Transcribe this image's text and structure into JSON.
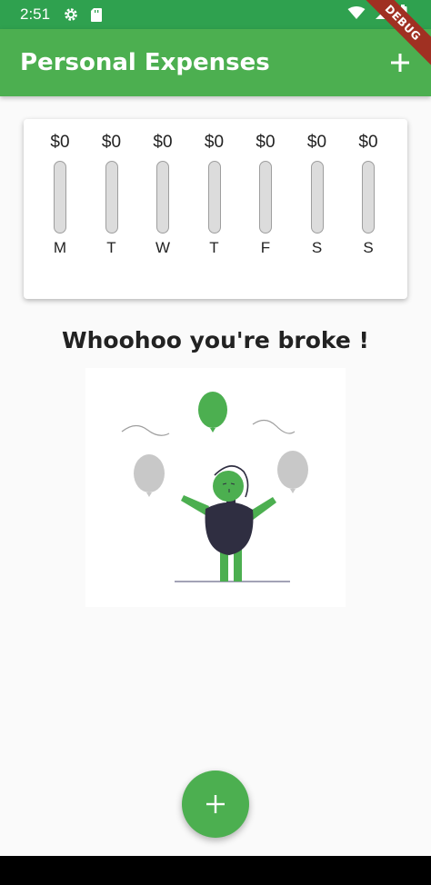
{
  "status_bar": {
    "time": "2:51"
  },
  "debug_banner": "DEBUG",
  "app_bar": {
    "title": "Personal Expenses"
  },
  "chart": {
    "bars": [
      {
        "day": "M",
        "amount": "$0",
        "fill_fraction": 0
      },
      {
        "day": "T",
        "amount": "$0",
        "fill_fraction": 0
      },
      {
        "day": "W",
        "amount": "$0",
        "fill_fraction": 0
      },
      {
        "day": "T",
        "amount": "$0",
        "fill_fraction": 0
      },
      {
        "day": "F",
        "amount": "$0",
        "fill_fraction": 0
      },
      {
        "day": "S",
        "amount": "$0",
        "fill_fraction": 0
      },
      {
        "day": "S",
        "amount": "$0",
        "fill_fraction": 0
      }
    ]
  },
  "empty_state": {
    "message": "Whoohoo you're broke !"
  },
  "colors": {
    "primary": "#4caf50",
    "status_bar": "#2fa14f",
    "illustration_dark": "#2f2e41",
    "balloon_gray": "#c8c8c8"
  },
  "icons": {
    "app_bar_add": "add-icon",
    "fab": "add-icon"
  }
}
